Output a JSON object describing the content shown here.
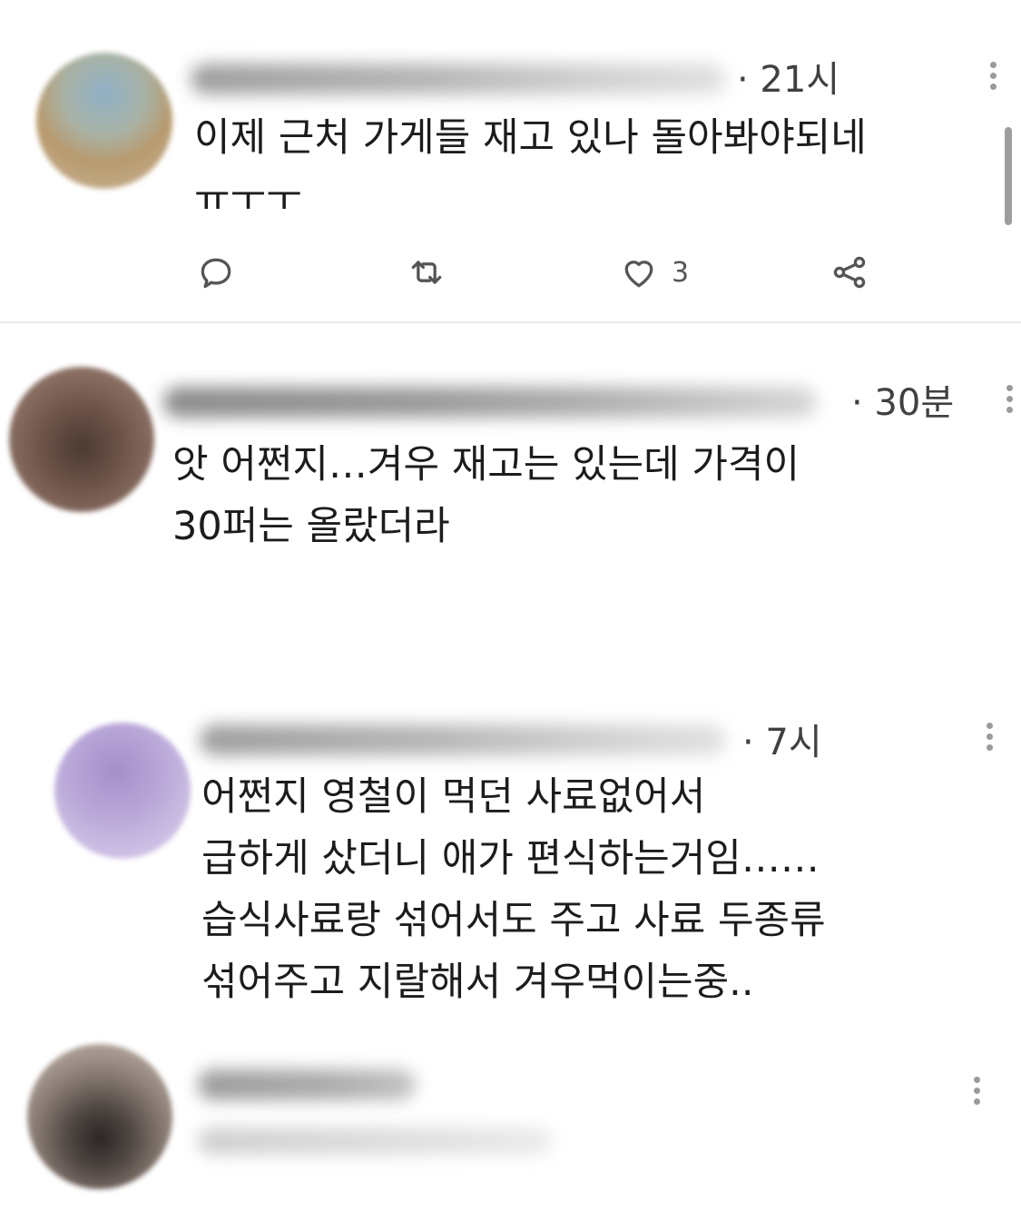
{
  "tweets": [
    {
      "time": "· 21시",
      "lines": [
        "이제 근처 가게들 재고 있나 돌아봐야되네",
        "ㅠㅜㅜ"
      ],
      "actions": {
        "like_count": "3"
      }
    },
    {
      "time": "· 30분",
      "lines": [
        "앗 어쩐지…겨우 재고는 있는데 가격이",
        "30퍼는 올랐더라"
      ]
    },
    {
      "time": "· 7시",
      "lines": [
        "어쩐지 영철이 먹던 사료없어서",
        "급하게 샀더니 애가 편식하는거임……",
        "습식사료랑 섞어서도 주고 사료 두종류",
        "섞어주고 지랄해서 겨우먹이는중.."
      ]
    },
    {
      "time": "",
      "lines": []
    }
  ],
  "icons": {
    "reply": "reply-icon",
    "retweet": "retweet-icon",
    "like": "heart-icon",
    "share": "share-icon",
    "more": "more-vertical-icon"
  },
  "colors": {
    "text": "#1c1c1c",
    "meta": "#404040",
    "icon": "#555555",
    "divider": "#eaeaea"
  }
}
